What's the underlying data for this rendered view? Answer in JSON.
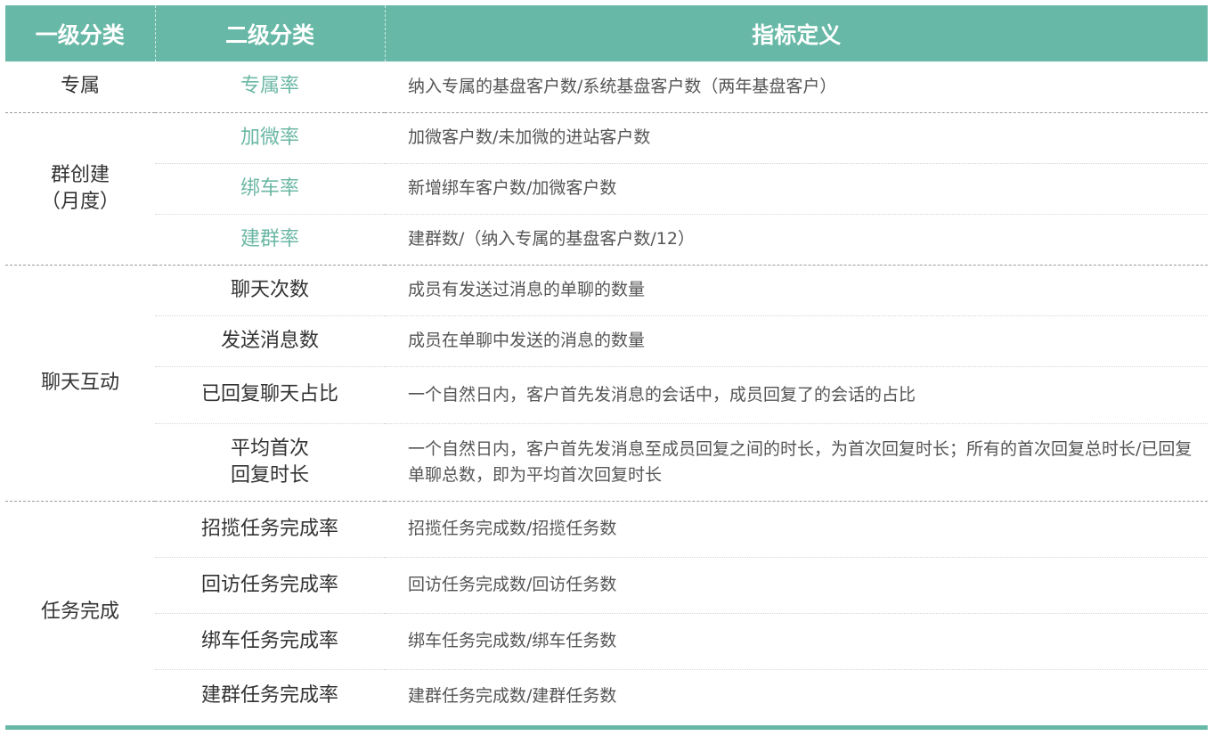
{
  "header": {
    "col1": "一级分类",
    "col2": "二级分类",
    "col3": "指标定义"
  },
  "groups": [
    {
      "category": "专属",
      "rows": [
        {
          "sub": "专属率",
          "def": "纳入专属的基盘客户数/系统基盘客户数（两年基盘客户）"
        }
      ]
    },
    {
      "category": "群创建\n（月度）",
      "rows": [
        {
          "sub": "加微率",
          "def": "加微客户数/未加微的进站客户数"
        },
        {
          "sub": "绑车率",
          "def": "新增绑车客户数/加微客户数"
        },
        {
          "sub": "建群率",
          "def": "建群数/（纳入专属的基盘客户数/12）"
        }
      ]
    },
    {
      "category": "聊天互动",
      "rows": [
        {
          "sub": "聊天次数",
          "def": "成员有发送过消息的单聊的数量"
        },
        {
          "sub": "发送消息数",
          "def": "成员在单聊中发送的消息的数量"
        },
        {
          "sub": "已回复聊天占比",
          "def": "一个自然日内，客户首先发消息的会话中，成员回复了的会话的占比"
        },
        {
          "sub": "平均首次\n回复时长",
          "def": "一个自然日内，客户首先发消息至成员回复之间的时长，为首次回复时长；所有的首次回复总时长/已回复单聊总数，即为平均首次回复时长"
        }
      ]
    },
    {
      "category": "任务完成",
      "rows": [
        {
          "sub": "招揽任务完成率",
          "def": "招揽任务完成数/招揽任务数"
        },
        {
          "sub": "回访任务完成率",
          "def": "回访任务完成数/回访任务数"
        },
        {
          "sub": "绑车任务完成率",
          "def": "绑车任务完成数/绑车任务数"
        },
        {
          "sub": "建群任务完成率",
          "def": "建群任务完成数/建群任务数"
        }
      ]
    }
  ],
  "colors": {
    "header_bg": "#67b8a6",
    "accent_text": "#6cb8a5"
  }
}
